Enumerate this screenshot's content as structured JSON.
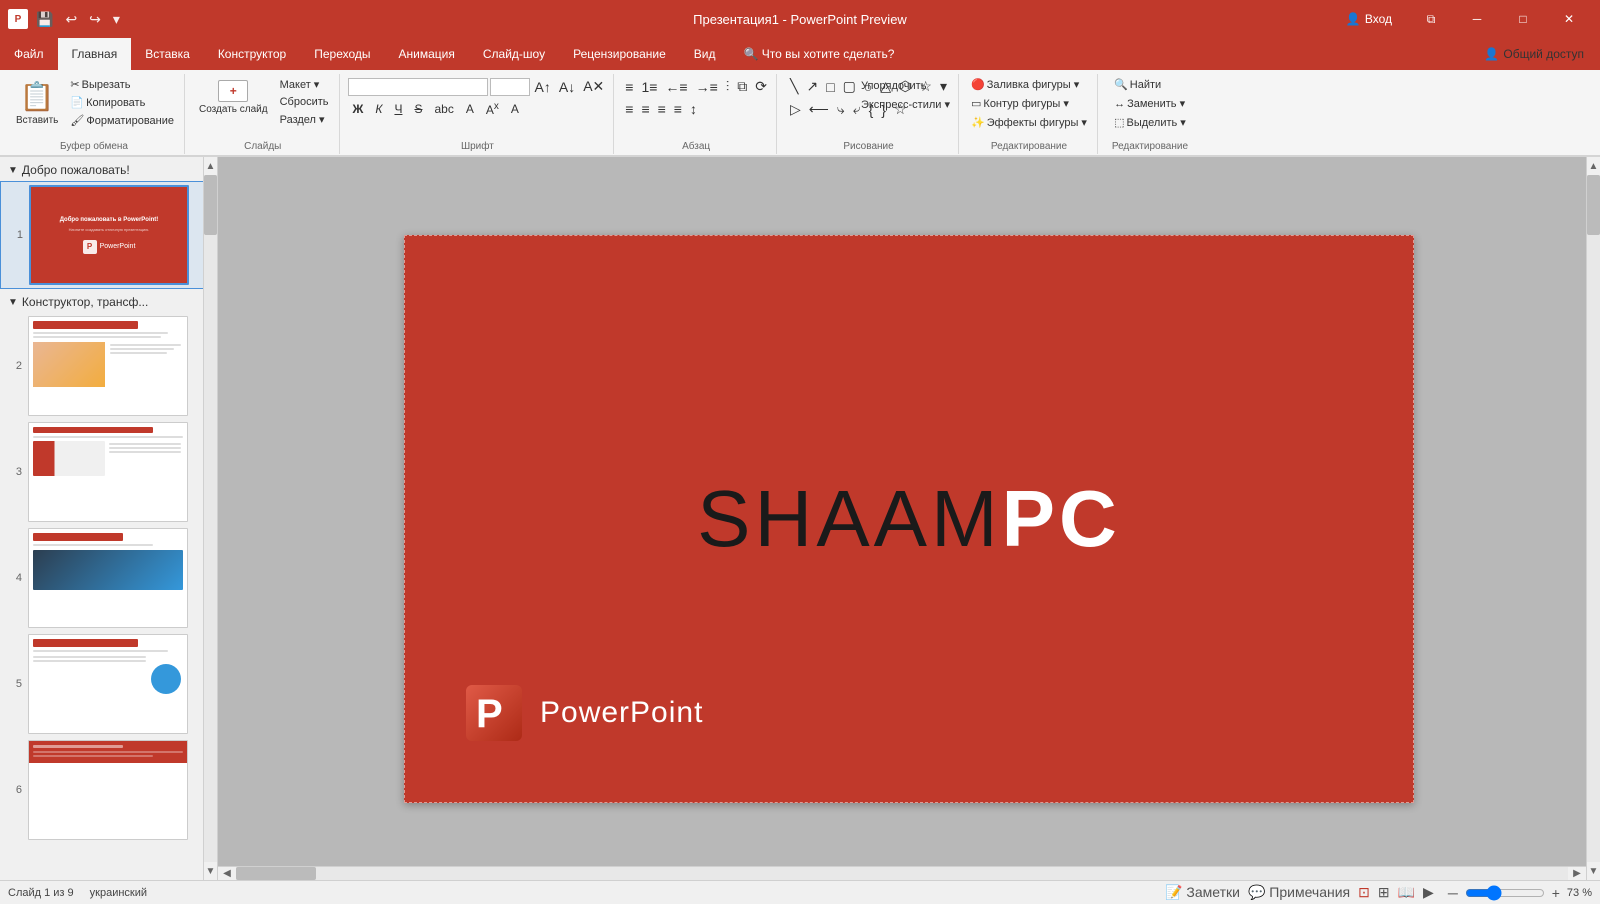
{
  "window": {
    "title": "Презентация1 - PowerPoint Preview",
    "titleLeft": "Презентация1",
    "titleRight": "PowerPoint Preview"
  },
  "quickAccess": {
    "save": "💾",
    "undo": "↩",
    "redo": "↪",
    "customize": "▾"
  },
  "winControls": {
    "signin": "Вход",
    "restore": "⧉",
    "minimize": "─",
    "maximize": "□",
    "close": "✕"
  },
  "ribbonTabs": [
    {
      "label": "Файл",
      "active": false
    },
    {
      "label": "Главная",
      "active": true
    },
    {
      "label": "Вставка",
      "active": false
    },
    {
      "label": "Конструктор",
      "active": false
    },
    {
      "label": "Переходы",
      "active": false
    },
    {
      "label": "Анимация",
      "active": false
    },
    {
      "label": "Слайд-шоу",
      "active": false
    },
    {
      "label": "Рецензирование",
      "active": false
    },
    {
      "label": "Вид",
      "active": false
    },
    {
      "label": "🔍 Что вы хотите сделать?",
      "active": false
    }
  ],
  "ribbonGroups": {
    "clipboard": {
      "label": "Буфер обмена",
      "paste": "Вставить",
      "copy": "Копировать",
      "cut": "Вырезать",
      "formatPainter": "Форматирование"
    },
    "slides": {
      "label": "Слайды",
      "newSlide": "Создать слайд",
      "layout": "Макет ▾",
      "reset": "Сбросить",
      "section": "Раздел ▾"
    },
    "font": {
      "label": "Шрифт",
      "fontName": "",
      "fontSize": "",
      "bold": "Ж",
      "italic": "К",
      "underline": "Ч",
      "strikethrough": "S"
    },
    "paragraph": {
      "label": "Абзац"
    },
    "drawing": {
      "label": "Рисование",
      "arrange": "Упорядочить",
      "quickStyles": "Экспресс-стили ▾",
      "shapeFill": "Заливка фигуры ▾",
      "shapeOutline": "Контур фигуры ▾",
      "shapeEffects": "Эффекты фигуры ▾"
    },
    "editing": {
      "label": "Редактирование",
      "find": "Найти",
      "replace": "Заменить ▾",
      "select": "Выделить ▾"
    }
  },
  "slidePanel": {
    "sections": [
      {
        "title": "Добро пожаловать!",
        "slides": [
          {
            "num": 1,
            "selected": true
          }
        ]
      },
      {
        "title": "Конструктор, трансф...",
        "slides": [
          {
            "num": 2,
            "selected": false
          },
          {
            "num": 3,
            "selected": false
          },
          {
            "num": 4,
            "selected": false
          },
          {
            "num": 5,
            "selected": false
          },
          {
            "num": 6,
            "selected": false
          }
        ]
      }
    ]
  },
  "mainSlide": {
    "brandTextDark": "SHAAMPC",
    "brandTextDarkPart": "SHAAM",
    "brandTextWhitePart": "PC",
    "logoLabel": "PowerPoint",
    "bgColor": "#c0392b"
  },
  "statusBar": {
    "slideInfo": "Слайд 1 из 9",
    "language": "украинский",
    "notes": "Заметки",
    "comments": "Примечания",
    "zoom": "73 %",
    "zoomLevel": 73
  }
}
